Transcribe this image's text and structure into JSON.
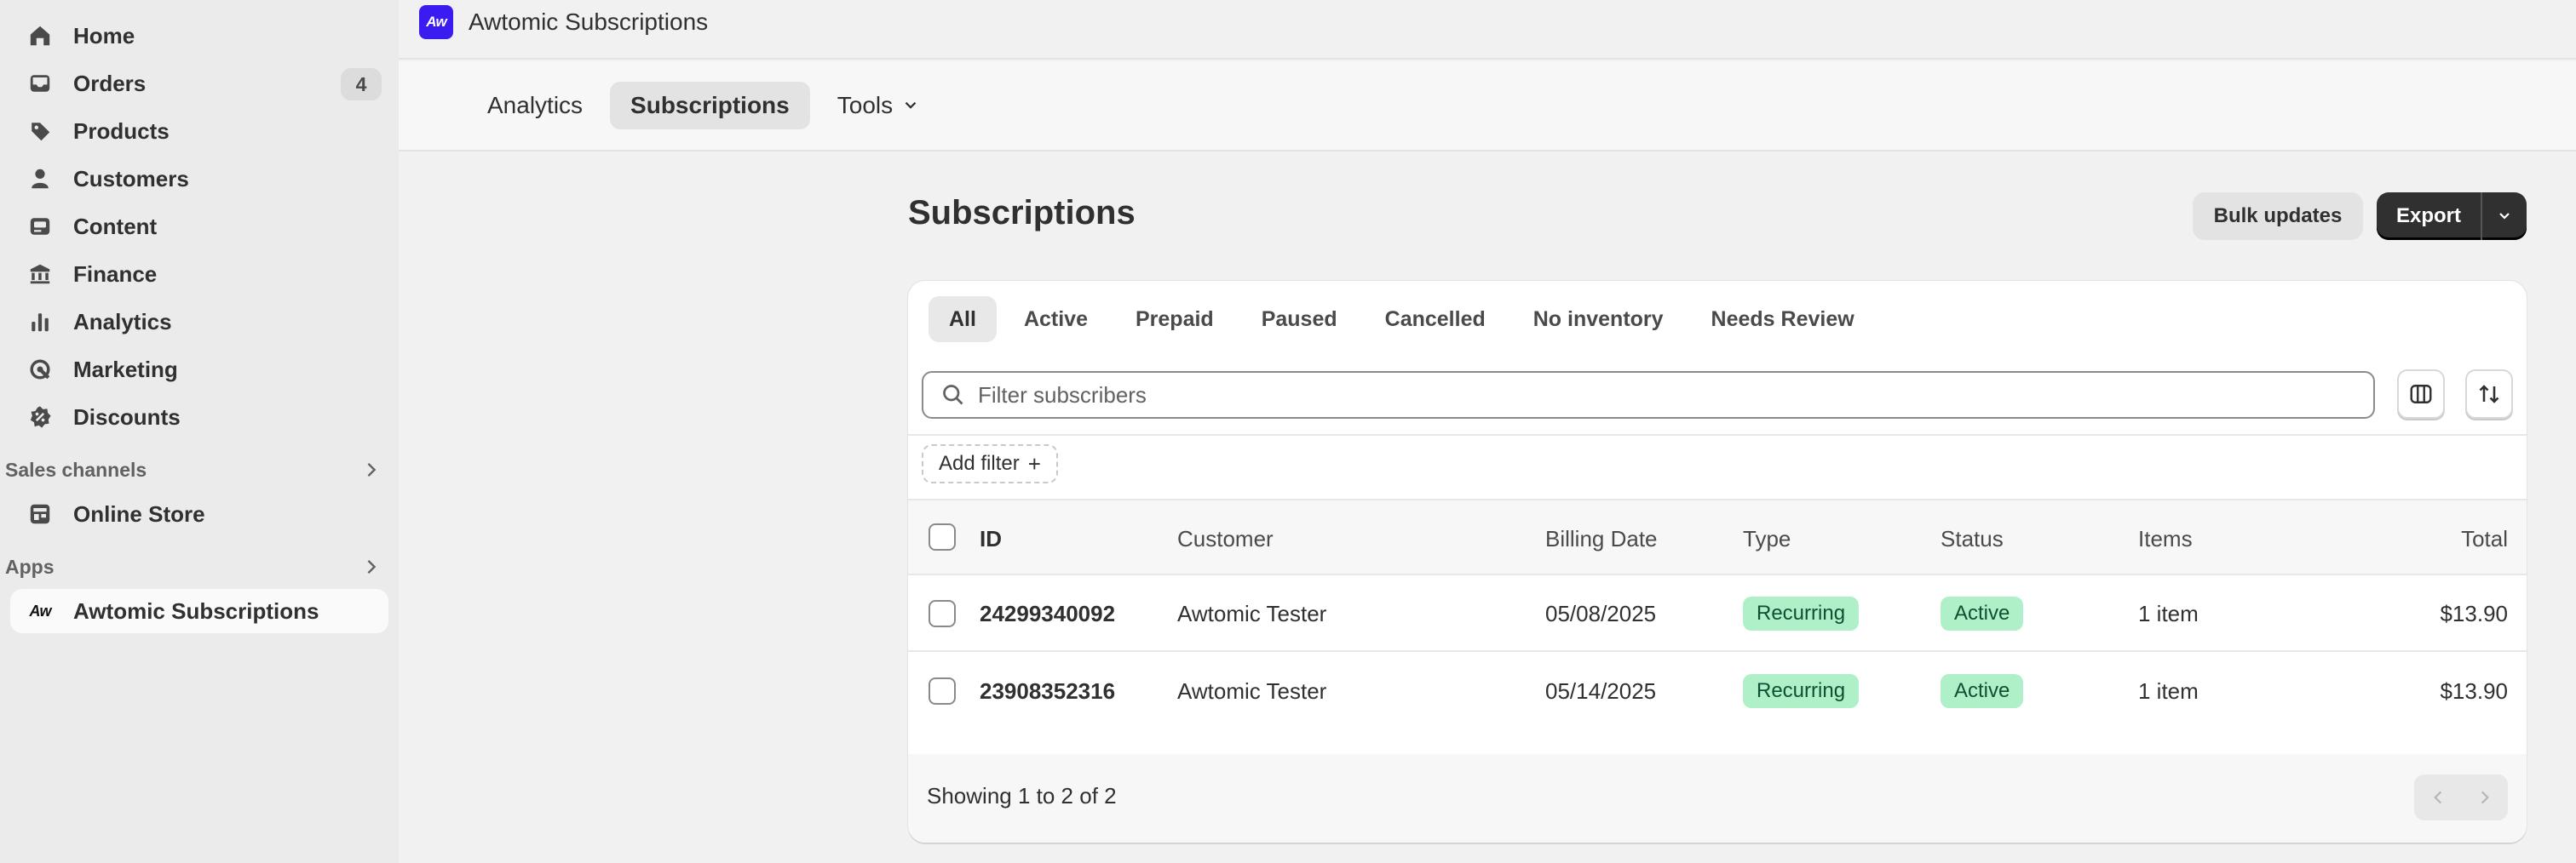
{
  "sidebar": {
    "items": [
      {
        "label": "Home",
        "icon": "home-icon"
      },
      {
        "label": "Orders",
        "icon": "inbox-icon",
        "badge": "4"
      },
      {
        "label": "Products",
        "icon": "tag-icon"
      },
      {
        "label": "Customers",
        "icon": "person-icon"
      },
      {
        "label": "Content",
        "icon": "image-icon"
      },
      {
        "label": "Finance",
        "icon": "bank-icon"
      },
      {
        "label": "Analytics",
        "icon": "bar-chart-icon"
      },
      {
        "label": "Marketing",
        "icon": "target-icon"
      },
      {
        "label": "Discounts",
        "icon": "discount-icon"
      }
    ],
    "sales_channels": {
      "heading": "Sales channels",
      "items": [
        {
          "label": "Online Store",
          "icon": "store-icon"
        }
      ]
    },
    "apps": {
      "heading": "Apps",
      "items": [
        {
          "label": "Awtomic Subscriptions",
          "logo": "Aw"
        }
      ]
    }
  },
  "app_header": {
    "logo": "Aw",
    "title": "Awtomic Subscriptions"
  },
  "app_tabs": [
    {
      "label": "Analytics"
    },
    {
      "label": "Subscriptions"
    },
    {
      "label": "Tools"
    }
  ],
  "page": {
    "title": "Subscriptions",
    "bulk_updates_label": "Bulk updates",
    "export_label": "Export"
  },
  "filter_tabs": [
    "All",
    "Active",
    "Prepaid",
    "Paused",
    "Cancelled",
    "No inventory",
    "Needs Review"
  ],
  "search": {
    "placeholder": "Filter subscribers",
    "value": ""
  },
  "add_filter_label": "Add filter",
  "table": {
    "headers": {
      "id": "ID",
      "customer": "Customer",
      "billing_date": "Billing Date",
      "type": "Type",
      "status": "Status",
      "items": "Items",
      "total": "Total"
    },
    "rows": [
      {
        "id": "24299340092",
        "customer": "Awtomic Tester",
        "billing_date": "05/08/2025",
        "type": "Recurring",
        "status": "Active",
        "items": "1 item",
        "total": "$13.90"
      },
      {
        "id": "23908352316",
        "customer": "Awtomic Tester",
        "billing_date": "05/14/2025",
        "type": "Recurring",
        "status": "Active",
        "items": "1 item",
        "total": "$13.90"
      }
    ]
  },
  "footer": {
    "showing": "Showing 1 to 2 of 2"
  },
  "colors": {
    "app_logo_bg": "#3a1cf0",
    "pill_bg": "#aff0c8",
    "pill_text": "#0c5132",
    "primary_button": "#303030"
  }
}
